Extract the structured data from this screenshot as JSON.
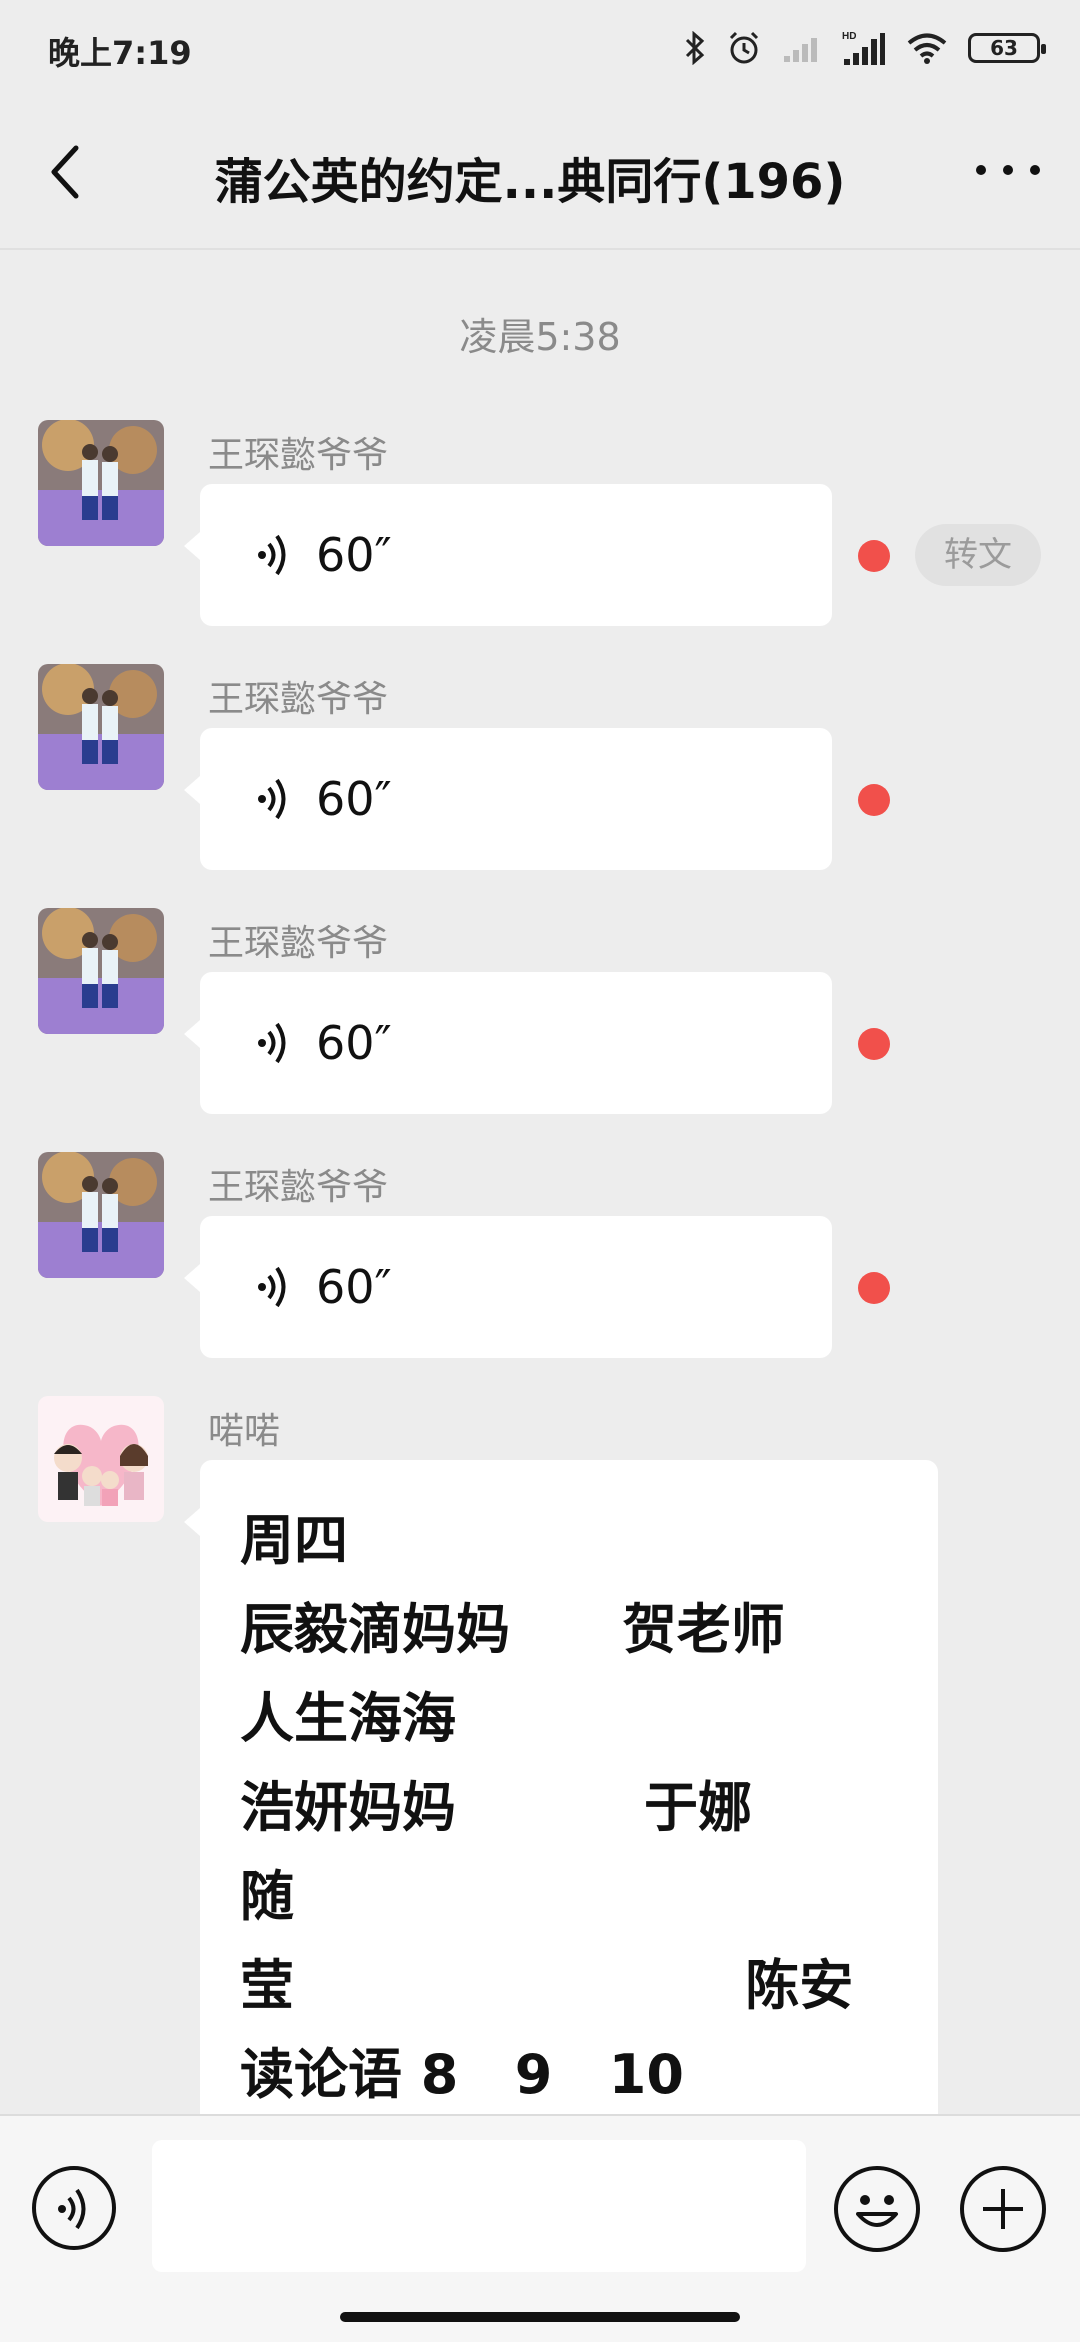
{
  "status_bar": {
    "time": "晚上7:19",
    "battery": "63",
    "icons": [
      "bluetooth-icon",
      "alarm-icon",
      "signal-weak-icon",
      "hd-signal-icon",
      "wifi-icon",
      "battery-icon"
    ]
  },
  "header": {
    "title": "蒲公英的约定...典同行(196)",
    "back_icon": "chevron-left-icon",
    "more_icon": "ellipsis-icon"
  },
  "chat": {
    "time_separator": "凌晨5:38",
    "voice_messages": [
      {
        "sender": "王琛懿爷爷",
        "duration": "60″",
        "unread": true,
        "to_text_label": "转文"
      },
      {
        "sender": "王琛懿爷爷",
        "duration": "60″",
        "unread": true
      },
      {
        "sender": "王琛懿爷爷",
        "duration": "60″",
        "unread": true
      },
      {
        "sender": "王琛懿爷爷",
        "duration": "60″",
        "unread": true
      }
    ],
    "text_message": {
      "sender": "喏喏",
      "lines": [
        "周四",
        "辰毅滴妈妈      贺老师",
        "人生海海",
        "浩妍妈妈          于娜",
        "随",
        "莹                        陈安",
        "读论语 8   9   10"
      ]
    }
  },
  "input_bar": {
    "message_value": "",
    "voice_icon": "voice-input-icon",
    "emoji_icon": "emoji-icon",
    "plus_icon": "plus-icon"
  }
}
